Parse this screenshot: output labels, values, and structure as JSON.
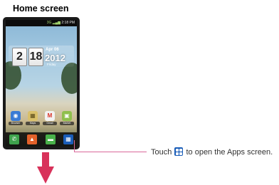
{
  "heading": "Home screen",
  "phone": {
    "status_time": "2:18 PM",
    "status_signal": "3G ▂▄▆",
    "clock_hour": "2",
    "clock_minute": "18",
    "clock_date": "Apr 06",
    "clock_year": "2012",
    "clock_weekday": "Friday",
    "apps": [
      {
        "label": "Browser",
        "icon": "globe-icon",
        "color": "#3a7bd5",
        "glyph": "◉"
      },
      {
        "label": "Maps",
        "icon": "map-icon",
        "color": "#d9c06a",
        "glyph": "▦"
      },
      {
        "label": "Gmail",
        "icon": "mail-icon",
        "color": "#f2f2f2",
        "glyph": "M"
      },
      {
        "label": "Market",
        "icon": "market-bag-icon",
        "color": "#8fbf4d",
        "glyph": "▣"
      }
    ],
    "dock": [
      {
        "icon": "phone-icon",
        "color": "#3fa34d",
        "glyph": "✆"
      },
      {
        "icon": "contacts-icon",
        "color": "#e2612a",
        "glyph": "▲"
      },
      {
        "icon": "messaging-icon",
        "color": "#49b24a",
        "glyph": "▬"
      },
      {
        "icon": "applications-icon",
        "color": "#1a5db8",
        "glyph": "▦"
      }
    ]
  },
  "instruction": {
    "before": "Touch ",
    "after": " to open the Apps screen."
  },
  "colors": {
    "callout_line": "#d9689a",
    "arrow": "#d8325a",
    "apps_icon": "#1a5db8"
  }
}
